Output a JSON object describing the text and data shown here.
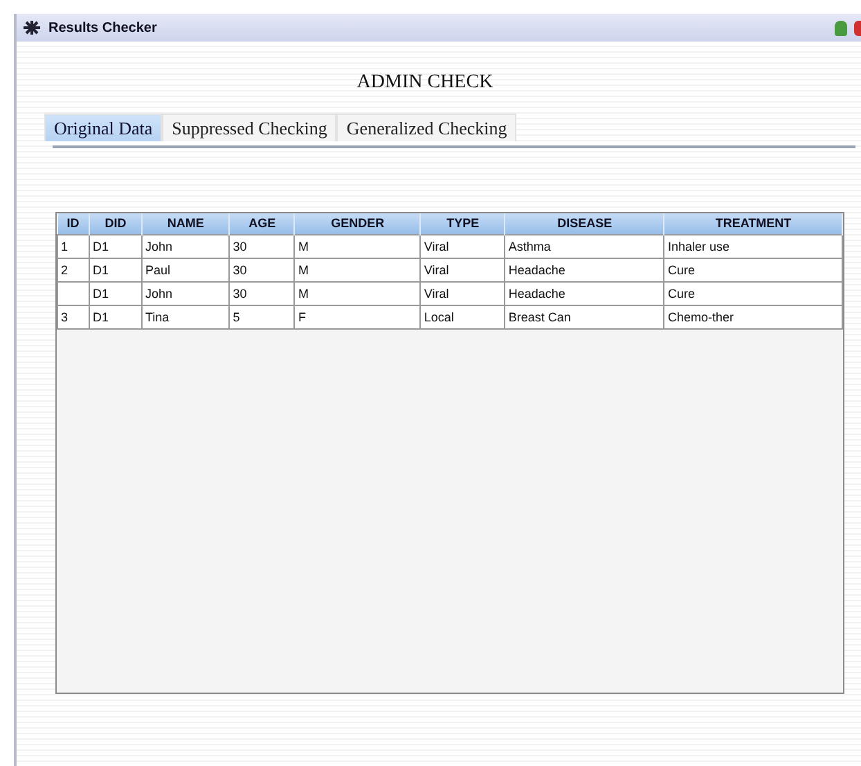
{
  "window": {
    "title": "Results Checker"
  },
  "heading": "ADMIN CHECK",
  "tabs": [
    {
      "label": "Original Data",
      "selected": true
    },
    {
      "label": "Suppressed Checking",
      "selected": false
    },
    {
      "label": "Generalized Checking",
      "selected": false
    }
  ],
  "table": {
    "columns": [
      "ID",
      "DID",
      "NAME",
      "AGE",
      "GENDER",
      "TYPE",
      "DISEASE",
      "TREATMENT"
    ],
    "rows": [
      [
        "1",
        "D1",
        "John",
        "30",
        "M",
        "Viral",
        "Asthma",
        "Inhaler use"
      ],
      [
        "2",
        "D1",
        "Paul",
        "30",
        "M",
        "Viral",
        "Headache",
        "Cure"
      ],
      [
        "",
        "D1",
        "John",
        "30",
        "M",
        "Viral",
        "Headache",
        "Cure"
      ],
      [
        "3",
        "D1",
        "Tina",
        "5",
        "F",
        "Local",
        "Breast Can",
        "Chemo-ther"
      ]
    ]
  }
}
